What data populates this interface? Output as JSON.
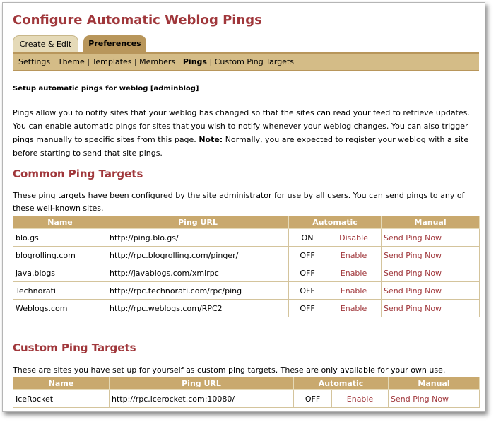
{
  "page": {
    "title": "Configure Automatic Weblog Pings"
  },
  "tabs": [
    {
      "label": "Create & Edit",
      "active": false
    },
    {
      "label": "Preferences",
      "active": true
    }
  ],
  "subnav": {
    "items": [
      "Settings",
      "Theme",
      "Templates",
      "Members",
      "Pings",
      "Custom Ping Targets"
    ],
    "current": "Pings",
    "separator": "|"
  },
  "setup_heading": "Setup automatic pings for weblog [adminblog]",
  "intro": {
    "text": "Pings allow you to notify sites that your weblog has changed so that the sites can read your feed to retrieve updates. You can enable automatic pings for sites that you wish to notify whenever your weblog changes. You can also trigger pings manually to specific sites from this page.",
    "note_label": "Note:",
    "note_text": "Normally, you are expected to register your weblog with a site before starting to send that site pings."
  },
  "common": {
    "heading": "Common Ping Targets",
    "description": "These ping targets have been configured by the site administrator for use by all users. You can send pings to any of these well-known sites.",
    "columns": {
      "name": "Name",
      "url": "Ping URL",
      "automatic": "Automatic",
      "manual": "Manual"
    },
    "rows": [
      {
        "name": "blo.gs",
        "url": "http://ping.blo.gs/",
        "status": "ON",
        "toggle": "Disable",
        "manual": "Send Ping Now"
      },
      {
        "name": "blogrolling.com",
        "url": "http://rpc.blogrolling.com/pinger/",
        "status": "OFF",
        "toggle": "Enable",
        "manual": "Send Ping Now"
      },
      {
        "name": "java.blogs",
        "url": "http://javablogs.com/xmlrpc",
        "status": "OFF",
        "toggle": "Enable",
        "manual": "Send Ping Now"
      },
      {
        "name": "Technorati",
        "url": "http://rpc.technorati.com/rpc/ping",
        "status": "OFF",
        "toggle": "Enable",
        "manual": "Send Ping Now"
      },
      {
        "name": "Weblogs.com",
        "url": "http://rpc.weblogs.com/RPC2",
        "status": "OFF",
        "toggle": "Enable",
        "manual": "Send Ping Now"
      }
    ]
  },
  "custom": {
    "heading": "Custom Ping Targets",
    "description": "These are sites you have set up for yourself as custom ping targets. These are only available for your own use.",
    "columns": {
      "name": "Name",
      "url": "Ping URL",
      "automatic": "Automatic",
      "manual": "Manual"
    },
    "rows": [
      {
        "name": "IceRocket",
        "url": "http://rpc.icerocket.com:10080/",
        "status": "OFF",
        "toggle": "Enable",
        "manual": "Send Ping Now"
      }
    ]
  },
  "colors": {
    "title": "#a0373b",
    "link": "#a0373b",
    "tab_active": "#b8965b",
    "tab_inactive": "#e5dab8",
    "subnav_bg": "#d4bc87",
    "table_header": "#c9a96e"
  }
}
